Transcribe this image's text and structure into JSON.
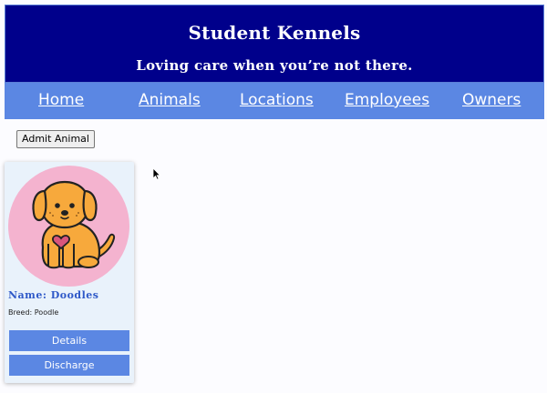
{
  "header": {
    "title": "Student Kennels",
    "tagline": "Loving care when you’re not there."
  },
  "nav": {
    "items": [
      {
        "label": "Home"
      },
      {
        "label": "Animals"
      },
      {
        "label": "Locations"
      },
      {
        "label": "Employees"
      },
      {
        "label": "Owners"
      }
    ]
  },
  "toolbar": {
    "admit_label": "Admit Animal"
  },
  "animals": [
    {
      "name": "Name: Doodles",
      "breed": "Breed: Poodle",
      "details_label": "Details",
      "discharge_label": "Discharge",
      "avatar_icon": "puppy-icon"
    }
  ],
  "colors": {
    "header_bg": "#00008b",
    "nav_bg": "#5b87e3",
    "card_bg": "#e9f2fb",
    "avatar_bg": "#f4b3cf",
    "name_text": "#2f59c8",
    "puppy_fur": "#f7a93c"
  }
}
